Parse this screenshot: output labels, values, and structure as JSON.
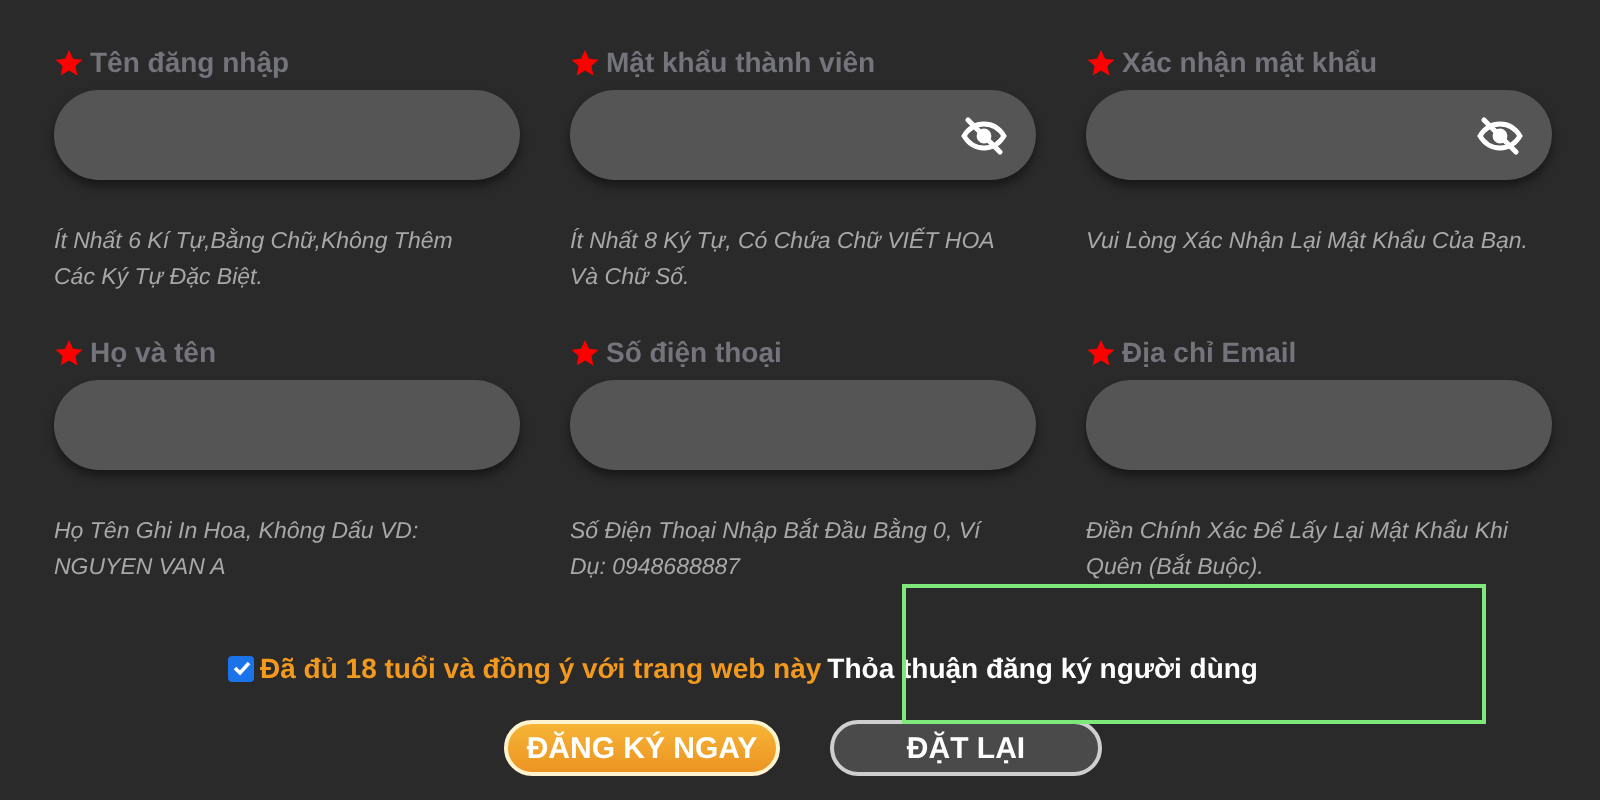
{
  "fields": [
    {
      "label": "Tên đăng nhập",
      "kind": "text",
      "required": true,
      "hint": "Ít Nhất 6 Kí Tự,Bằng Chữ,Không Thêm Các Ký Tự Đặc Biệt."
    },
    {
      "label": "Mật khẩu thành viên",
      "kind": "password",
      "required": true,
      "hint": "Ít Nhất 8 Ký Tự, Có Chứa Chữ VIẾT HOA Và Chữ Số."
    },
    {
      "label": "Xác nhận mật khẩu",
      "kind": "password",
      "required": true,
      "hint": "Vui Lòng Xác Nhận Lại Mật Khẩu Của Bạn."
    },
    {
      "label": "Họ và tên",
      "kind": "text",
      "required": true,
      "hint": "Họ Tên Ghi In Hoa, Không Dấu VD: NGUYEN VAN A"
    },
    {
      "label": "Số điện thoại",
      "kind": "text",
      "required": true,
      "hint": "Số Điện Thoại Nhập Bắt Đầu Bằng 0, Ví Dụ: 0948688887"
    },
    {
      "label": "Địa chỉ Email",
      "kind": "text",
      "required": true,
      "hint": "Điền Chính Xác Để Lấy Lại Mật Khẩu Khi Quên (Bắt Buộc)."
    }
  ],
  "agreement": {
    "checked": true,
    "text": "Đã đủ 18 tuổi và đồng ý với trang web này",
    "link": "Thỏa thuận đăng ký người dùng"
  },
  "buttons": [
    {
      "label": "ĐĂNG KÝ NGAY",
      "kind": "primary"
    },
    {
      "label": "ĐẶT LẠI",
      "kind": "secondary"
    }
  ]
}
